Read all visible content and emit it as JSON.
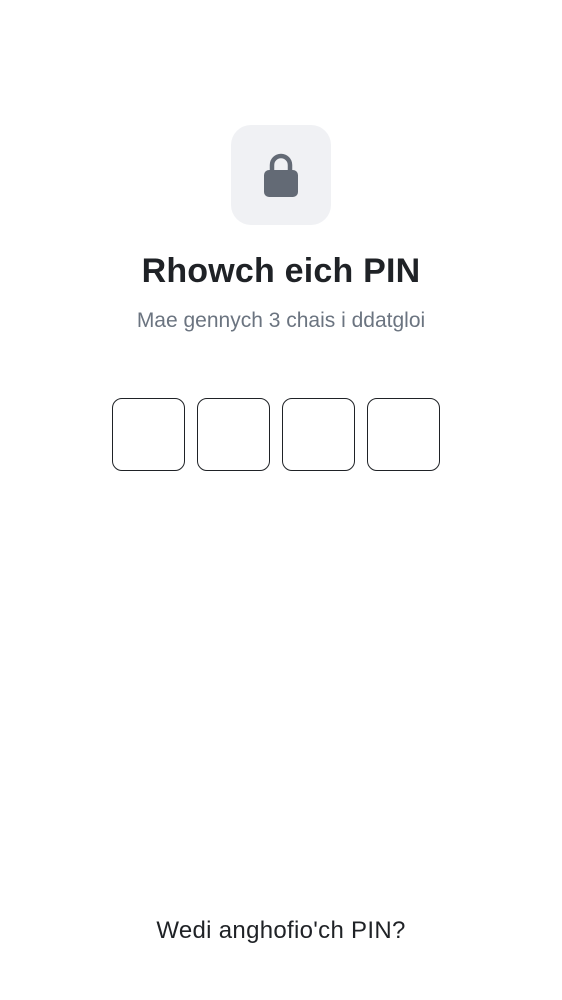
{
  "header": {
    "icon": "lock-icon",
    "title": "Rhowch eich PIN",
    "subtitle": "Mae gennych 3 chais i ddatgloi"
  },
  "pin": {
    "length": 4,
    "digits": [
      "",
      "",
      "",
      ""
    ]
  },
  "footer": {
    "forgot_label": "Wedi anghofio'ch PIN?"
  },
  "colors": {
    "text_primary": "#1f2226",
    "text_secondary": "#6b7480",
    "tile_background": "#f0f1f4",
    "icon": "#636a75"
  }
}
